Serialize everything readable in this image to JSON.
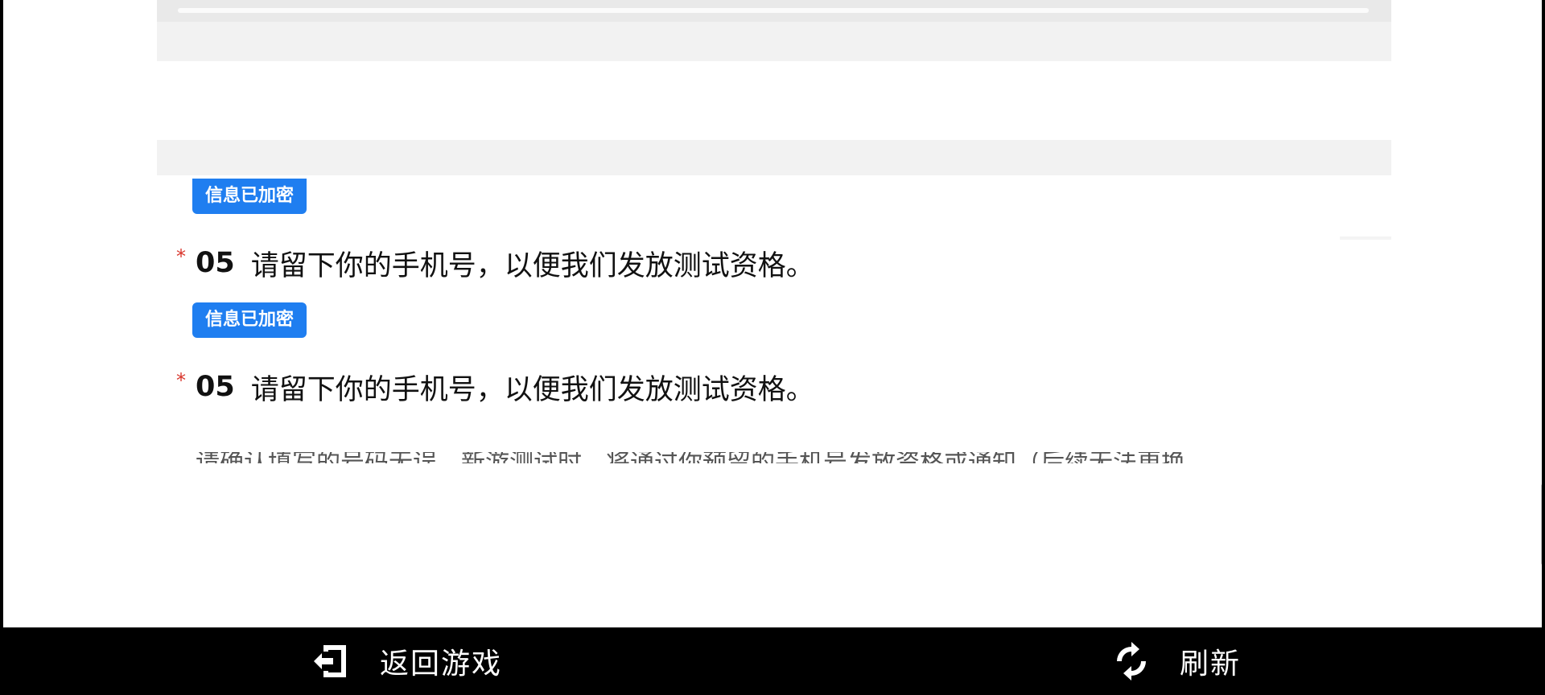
{
  "form": {
    "badge_1": "信息已加密",
    "badge_2": "信息已加密",
    "question_1": {
      "required_mark": "*",
      "number": "05",
      "text": "请留下你的手机号，以便我们发放测试资格。"
    },
    "question_2": {
      "required_mark": "*",
      "number": "05",
      "text": "请留下你的手机号，以便我们发放测试资格。"
    },
    "clipped_hint": "请确认填写的号码无误，新游测试时，将通过你预留的手机号发放资格或通知（后续无法更换"
  },
  "bottom_bar": {
    "back_icon": "exit-door-icon",
    "back_label": "返回游戏",
    "refresh_icon": "refresh-icon",
    "refresh_label": "刷新"
  },
  "colors": {
    "badge": "#1f7ef0",
    "required": "#d9362c",
    "bottom_bar_bg": "#000000"
  }
}
